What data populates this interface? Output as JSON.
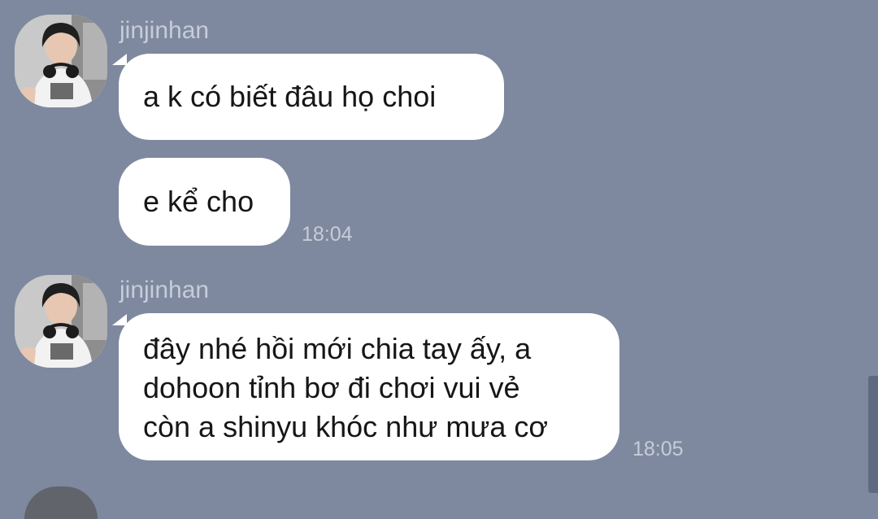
{
  "colors": {
    "background": "#7e899f",
    "bubble": "#ffffff",
    "meta_text": "#c6ccd9",
    "message_text": "#161616"
  },
  "messages": [
    {
      "sender": "jinjinhan",
      "bubbles": [
        {
          "lines": [
            "a k có biết đâu họ choi"
          ]
        },
        {
          "lines": [
            "e kể cho"
          ]
        }
      ],
      "time": "18:04"
    },
    {
      "sender": "jinjinhan",
      "bubbles": [
        {
          "lines": [
            "đây nhé hồi mới chia tay ấy, a",
            "dohoon tỉnh bơ đi chơi vui vẻ",
            "còn a shinyu khóc như mưa cơ"
          ]
        }
      ],
      "time": "18:05"
    }
  ]
}
